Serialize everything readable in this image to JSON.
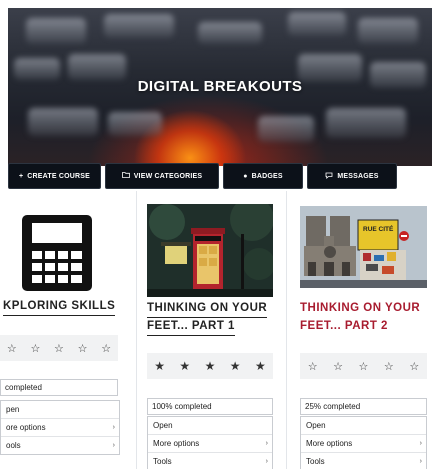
{
  "hero": {
    "title": "DIGITAL BREAKOUTS"
  },
  "nav": [
    {
      "label": "CREATE COURSE",
      "icon": "+"
    },
    {
      "label": "VIEW CATEGORIES",
      "icon": "folder"
    },
    {
      "label": "BADGES",
      "icon": "badge"
    },
    {
      "label": "MESSAGES",
      "icon": "chat"
    }
  ],
  "courses": [
    {
      "title": "XPLORING SKILLS",
      "title_partial": "KPLORING SKILLS",
      "progress": "completed",
      "menu": {
        "open": "pen",
        "more": "ore options",
        "tools": "ools"
      }
    },
    {
      "title": "THINKING ON YOUR FEET... PART 1",
      "title_line1": "THINKING ON YOUR",
      "title_line2": "FEET... PART 1",
      "progress": "100% completed",
      "rating_stars": 5,
      "rating_value": 5,
      "menu": {
        "open": "Open",
        "more": "More options",
        "tools": "Tools"
      }
    },
    {
      "title": "THINKING ON YOUR FEET... PART 2",
      "title_line1": "THINKING ON YOUR",
      "title_line2": "FEET... PART 2",
      "progress": "25% completed",
      "rating_value": 0,
      "menu": {
        "open": "Open",
        "more": "More options",
        "tools": "Tools"
      }
    }
  ],
  "image_text": {
    "sign": "RUE CITÉ"
  },
  "colors": {
    "red_title": "#a81c2f",
    "nav_bg": "#0c1119"
  }
}
